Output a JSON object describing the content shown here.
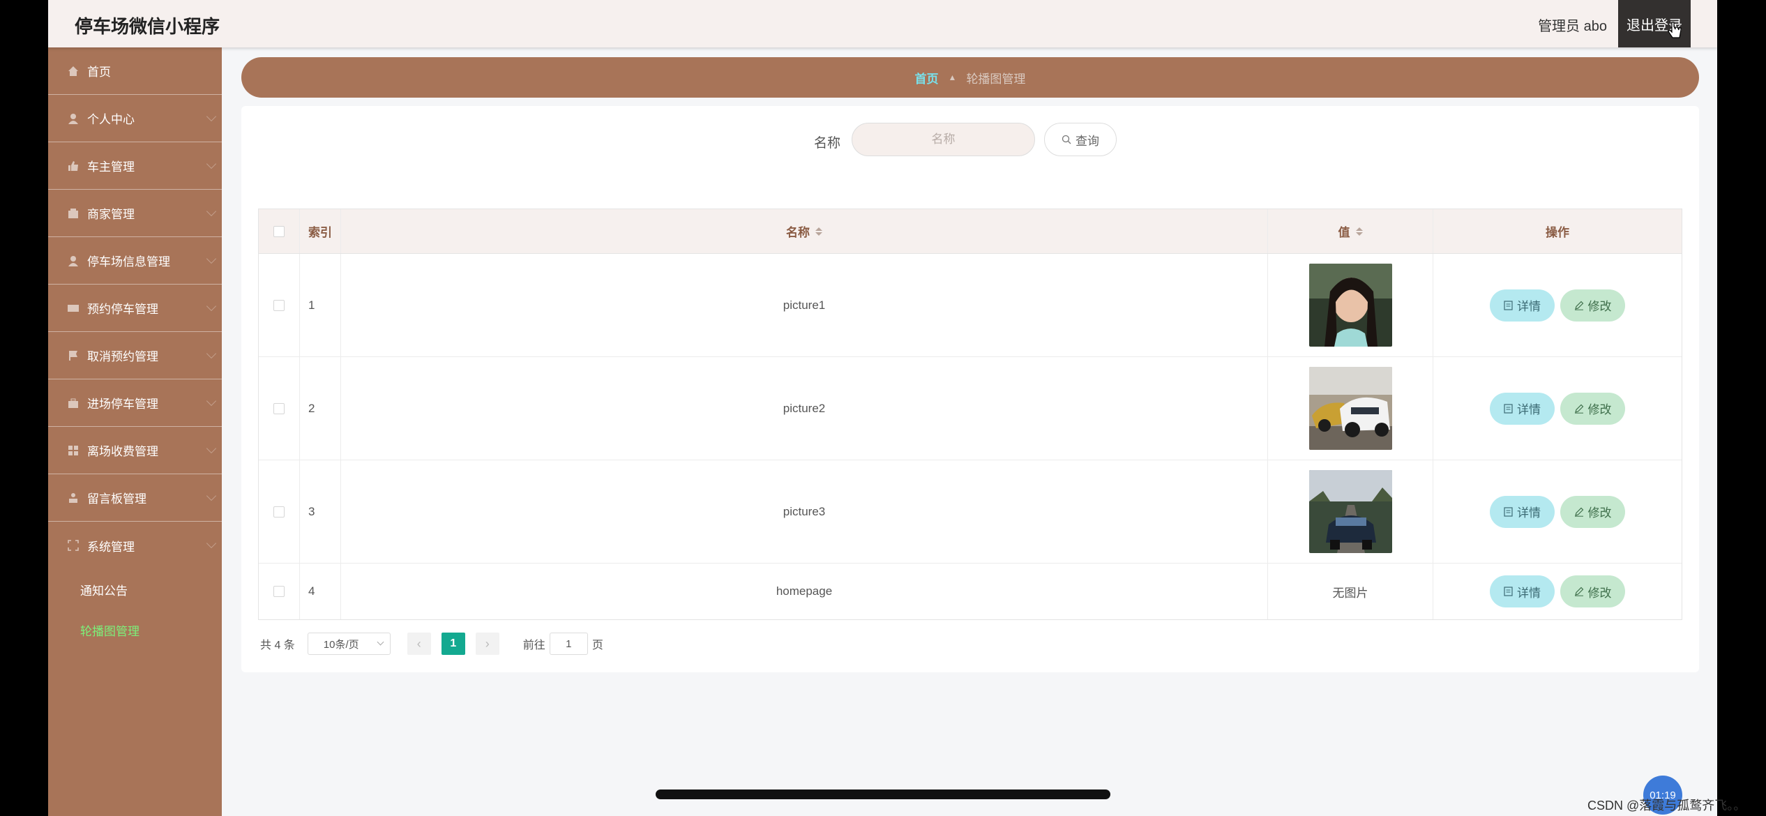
{
  "header": {
    "app_title": "停车场微信小程序",
    "admin_label": "管理员 abo",
    "logout_label": "退出登录"
  },
  "sidebar": {
    "items": [
      {
        "label": "首页",
        "icon": "home-icon"
      },
      {
        "label": "个人中心",
        "icon": "user-icon"
      },
      {
        "label": "车主管理",
        "icon": "thumb-icon"
      },
      {
        "label": "商家管理",
        "icon": "shop-icon"
      },
      {
        "label": "停车场信息管理",
        "icon": "user-icon"
      },
      {
        "label": "预约停车管理",
        "icon": "card-icon"
      },
      {
        "label": "取消预约管理",
        "icon": "flag-icon"
      },
      {
        "label": "进场停车管理",
        "icon": "briefcase-icon"
      },
      {
        "label": "离场收费管理",
        "icon": "grid-icon"
      },
      {
        "label": "留言板管理",
        "icon": "person-icon"
      },
      {
        "label": "系统管理",
        "icon": "fullscreen-icon"
      }
    ],
    "sub_items": [
      {
        "label": "通知公告",
        "active": false
      },
      {
        "label": "轮播图管理",
        "active": true
      }
    ]
  },
  "breadcrumb": {
    "home": "首页",
    "current": "轮播图管理"
  },
  "search": {
    "label": "名称",
    "placeholder": "名称",
    "query_label": "查询"
  },
  "table": {
    "headers": {
      "index": "索引",
      "name": "名称",
      "value": "值",
      "actions": "操作"
    },
    "rows": [
      {
        "index": "1",
        "name": "picture1",
        "value_type": "image",
        "value_text": ""
      },
      {
        "index": "2",
        "name": "picture2",
        "value_type": "image",
        "value_text": ""
      },
      {
        "index": "3",
        "name": "picture3",
        "value_type": "image",
        "value_text": ""
      },
      {
        "index": "4",
        "name": "homepage",
        "value_type": "text",
        "value_text": "无图片"
      }
    ],
    "detail_label": "详情",
    "edit_label": "修改"
  },
  "pagination": {
    "total": "共 4 条",
    "page_size": "10条/页",
    "current_page": "1",
    "goto_prefix": "前往",
    "goto_value": "1",
    "goto_suffix": "页"
  },
  "overlay": {
    "timer": "01:19",
    "watermark": "CSDN @落霞与孤鹜齐飞。。"
  },
  "colors": {
    "accent": "#a87458",
    "breadcrumb_home": "#79e0ea",
    "pager_active": "#13a990",
    "detail_btn": "#b4e9f0",
    "edit_btn": "#c5e8cf"
  }
}
